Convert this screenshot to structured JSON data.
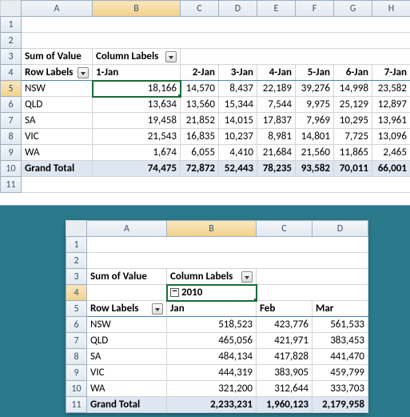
{
  "sheet1": {
    "cols": [
      "A",
      "B",
      "C",
      "D",
      "E",
      "F",
      "G",
      "H"
    ],
    "rows": [
      "1",
      "2",
      "3",
      "4",
      "5",
      "6",
      "7",
      "8",
      "9",
      "10",
      "11"
    ],
    "selected_col": "B",
    "selected_row": "5",
    "labels": {
      "sum_of_value": "Sum of Value",
      "column_labels": "Column Labels",
      "row_labels": "Row Labels",
      "grand_total": "Grand Total"
    },
    "date_headers": [
      "1-Jan",
      "2-Jan",
      "3-Jan",
      "4-Jan",
      "5-Jan",
      "6-Jan",
      "7-Jan"
    ],
    "data_rows": [
      {
        "label": "NSW",
        "vals": [
          "18,166",
          "14,570",
          "8,437",
          "22,189",
          "39,276",
          "14,998",
          "23,582"
        ]
      },
      {
        "label": "QLD",
        "vals": [
          "13,634",
          "13,560",
          "15,344",
          "7,544",
          "9,975",
          "25,129",
          "12,897"
        ]
      },
      {
        "label": "SA",
        "vals": [
          "19,458",
          "21,852",
          "14,015",
          "17,837",
          "7,969",
          "10,295",
          "13,961"
        ]
      },
      {
        "label": "VIC",
        "vals": [
          "21,543",
          "16,835",
          "10,237",
          "8,981",
          "14,801",
          "7,725",
          "13,096"
        ]
      },
      {
        "label": "WA",
        "vals": [
          "1,674",
          "6,055",
          "4,410",
          "21,684",
          "21,560",
          "11,865",
          "2,465"
        ]
      }
    ],
    "grand_totals": [
      "74,475",
      "72,872",
      "52,443",
      "78,235",
      "93,582",
      "70,011",
      "66,001"
    ]
  },
  "sheet2": {
    "cols": [
      "A",
      "B",
      "C",
      "D"
    ],
    "rows": [
      "1",
      "2",
      "3",
      "4",
      "5",
      "6",
      "7",
      "8",
      "9",
      "10",
      "11"
    ],
    "selected_col": "B",
    "selected_row": "4",
    "labels": {
      "sum_of_value": "Sum of Value",
      "column_labels": "Column Labels",
      "row_labels": "Row Labels",
      "grand_total": "Grand Total",
      "year": "2010"
    },
    "month_headers": [
      "Jan",
      "Feb",
      "Mar"
    ],
    "data_rows": [
      {
        "label": "NSW",
        "vals": [
          "518,523",
          "423,776",
          "561,533"
        ]
      },
      {
        "label": "QLD",
        "vals": [
          "465,056",
          "421,971",
          "383,453"
        ]
      },
      {
        "label": "SA",
        "vals": [
          "484,134",
          "417,828",
          "441,470"
        ]
      },
      {
        "label": "VIC",
        "vals": [
          "444,319",
          "383,905",
          "459,799"
        ]
      },
      {
        "label": "WA",
        "vals": [
          "321,200",
          "312,644",
          "333,703"
        ]
      }
    ],
    "grand_totals": [
      "2,233,231",
      "1,960,123",
      "2,179,958"
    ]
  }
}
